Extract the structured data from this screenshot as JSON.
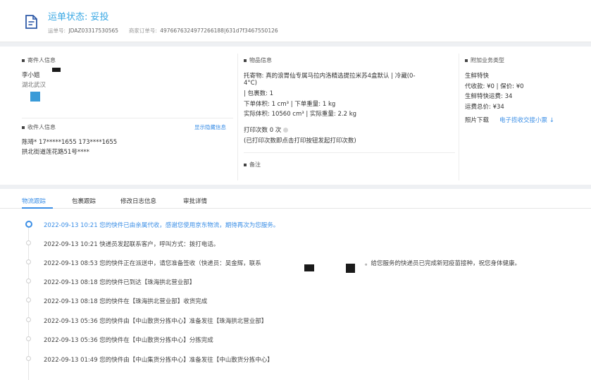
{
  "header": {
    "status_title": "运单状态: 妥投",
    "waybill_label": "运单号:",
    "waybill_no": "JDAZ03317530565",
    "merchant_label": "商家订单号:",
    "merchant_no": "497667632497726618​8|631d7f3467550126"
  },
  "sender": {
    "section_title": "寄件人信息",
    "name": "李小姐",
    "address": "湖北武汉"
  },
  "receiver": {
    "section_title": "收件人信息",
    "show_hidden_link": "显示隐藏信息",
    "name_phone": "陈琦*   17*****1655   173****1655",
    "address": "拱北街道莲花路51号****"
  },
  "goods": {
    "section_title": "物品信息",
    "item_line1": "托寄物:   真的浪胃仙专属马拉内洛精选提拉米苏4盒默认 | 冷藏(0-",
    "item_line2": "4°C)",
    "package_line": "| 包裹数:   1",
    "order_volume": "下单体积:    1 cm³ | 下单重量:    1 kg",
    "actual_volume": "实际体积:    10560 cm³ | 实际重量:    2.2 kg",
    "print_count": "打印次数   0 次",
    "print_note": "(已打印次数即点击打印按钮发起打印次数)",
    "remark_title": "备注"
  },
  "extra": {
    "section_title": "附加业务类型",
    "fresh_express": "生鲜特快",
    "cod_line": "代收款:   ¥0 | 保价:   ¥0",
    "fresh_fee": "生鲜特快运费:   34",
    "total_fee": "运费总价:   ¥34",
    "photo_label": "照片下载",
    "receipt_link": "电子揽收交接小票 ↓"
  },
  "tabs": [
    {
      "label": "物流跟踪"
    },
    {
      "label": "包裹跟踪"
    },
    {
      "label": "修改日志信息"
    },
    {
      "label": "审批详情"
    }
  ],
  "timeline": [
    {
      "text": "2022-09-13 10:21  您的快件已由亲属代收，感谢您使用京东物流，期待再次为您服务。"
    },
    {
      "text": "2022-09-13 10:21  快递员发起联系客户，呼叫方式：拨打电话。"
    },
    {
      "text": "2022-09-13 08:53  您的快件正在派送中，请您准备签收（快递员：吴金辉，联系"
    },
    {
      "text": "2022-09-13 08:18  您的快件已到达【珠海拱北营业部】"
    },
    {
      "text": "2022-09-13 08:18  您的快件在【珠海拱北营业部】收货完成"
    },
    {
      "text": "2022-09-13 05:36  您的快件由【中山散货分拣中心】准备发往【珠海拱北营业部】"
    },
    {
      "text": "2022-09-13 05:36  您的快件在【中山散货分拣中心】分拣完成"
    },
    {
      "text": "2022-09-13 01:49  您的快件由【中山集货分拣中心】准备发往【中山散货分拣中心】"
    }
  ],
  "timeline_tail": "。给您服务的快递员已完成新冠疫苗接种，祝您身体健康。"
}
